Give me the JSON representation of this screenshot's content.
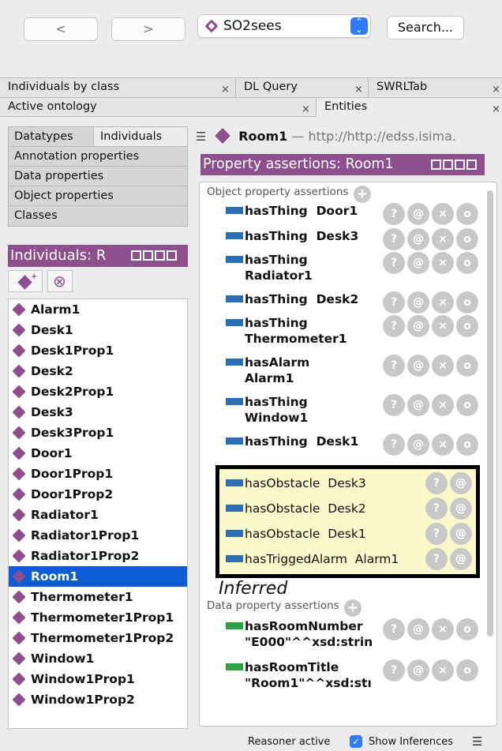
{
  "toolbar": {
    "back_label": "<",
    "forward_label": ">",
    "ontology": "SO2sees",
    "search_label": "Search..."
  },
  "tabs_row1": [
    {
      "label": "Individuals by class"
    },
    {
      "label": "DL Query"
    },
    {
      "label": "SWRLTab"
    }
  ],
  "tabs_row2": [
    {
      "label": "Active ontology"
    },
    {
      "label": "Entities"
    }
  ],
  "close_glyph": "×",
  "subtabs": {
    "datatypes": "Datatypes",
    "individuals": "Individuals",
    "annotation_properties": "Annotation properties",
    "data_properties": "Data properties",
    "object_properties": "Object properties",
    "classes": "Classes"
  },
  "individuals_header": "Individuals: R",
  "individuals": [
    "Alarm1",
    "Desk1",
    "Desk1Prop1",
    "Desk2",
    "Desk2Prop1",
    "Desk3",
    "Desk3Prop1",
    "Door1",
    "Door1Prop1",
    "Door1Prop2",
    "Radiator1",
    "Radiator1Prop1",
    "Radiator1Prop2",
    "Room1",
    "Thermometer1",
    "Thermometer1Prop1",
    "Thermometer1Prop2",
    "Window1",
    "Window1Prop1",
    "Window1Prop2"
  ],
  "selected_individual": "Room1",
  "entity": {
    "name": "Room1",
    "dash": " — ",
    "url": "http://http://edss.isima."
  },
  "property_assertions_header": "Property assertions: Room1",
  "object_property_assertions": {
    "heading": "Object property assertions",
    "rows": [
      {
        "line1": "hasThing  Door1",
        "line2": ""
      },
      {
        "line1": "hasThing  Desk3",
        "line2": ""
      },
      {
        "line1": "hasThing",
        "line2": "Radiator1"
      },
      {
        "line1": "hasThing  Desk2",
        "line2": ""
      },
      {
        "line1": "hasThing",
        "line2": "Thermometer1"
      },
      {
        "line1": "hasAlarm",
        "line2": "Alarm1"
      },
      {
        "line1": "hasThing",
        "line2": "Window1"
      },
      {
        "line1": "hasThing  Desk1",
        "line2": ""
      }
    ]
  },
  "inferred_assertions": [
    "hasObstacle  Desk3",
    "hasObstacle  Desk2",
    "hasObstacle  Desk1",
    "hasTriggedAlarm  Alarm1"
  ],
  "inferred_label": "Inferred",
  "data_property_assertions": {
    "heading": "Data property assertions",
    "rows": [
      {
        "line1": "hasRoomNumber",
        "line2": "\"E000\"^^xsd:strin"
      },
      {
        "line1": "hasRoomTitle",
        "line2": "\"Room1\"^^xsd:stı"
      }
    ]
  },
  "button_glyphs": {
    "help": "?",
    "annotate": "@",
    "delete": "×",
    "edit": "o",
    "add": "+"
  },
  "status": {
    "reasoner": "Reasoner active",
    "show_inferences": "Show Inferences"
  },
  "colors": {
    "header_purple": "#8e4f8e",
    "selection_blue": "#0b5cd5",
    "object_property_blue": "#2a6fb4",
    "data_property_green": "#2da244",
    "inferred_bg": "#fbf8cc"
  }
}
